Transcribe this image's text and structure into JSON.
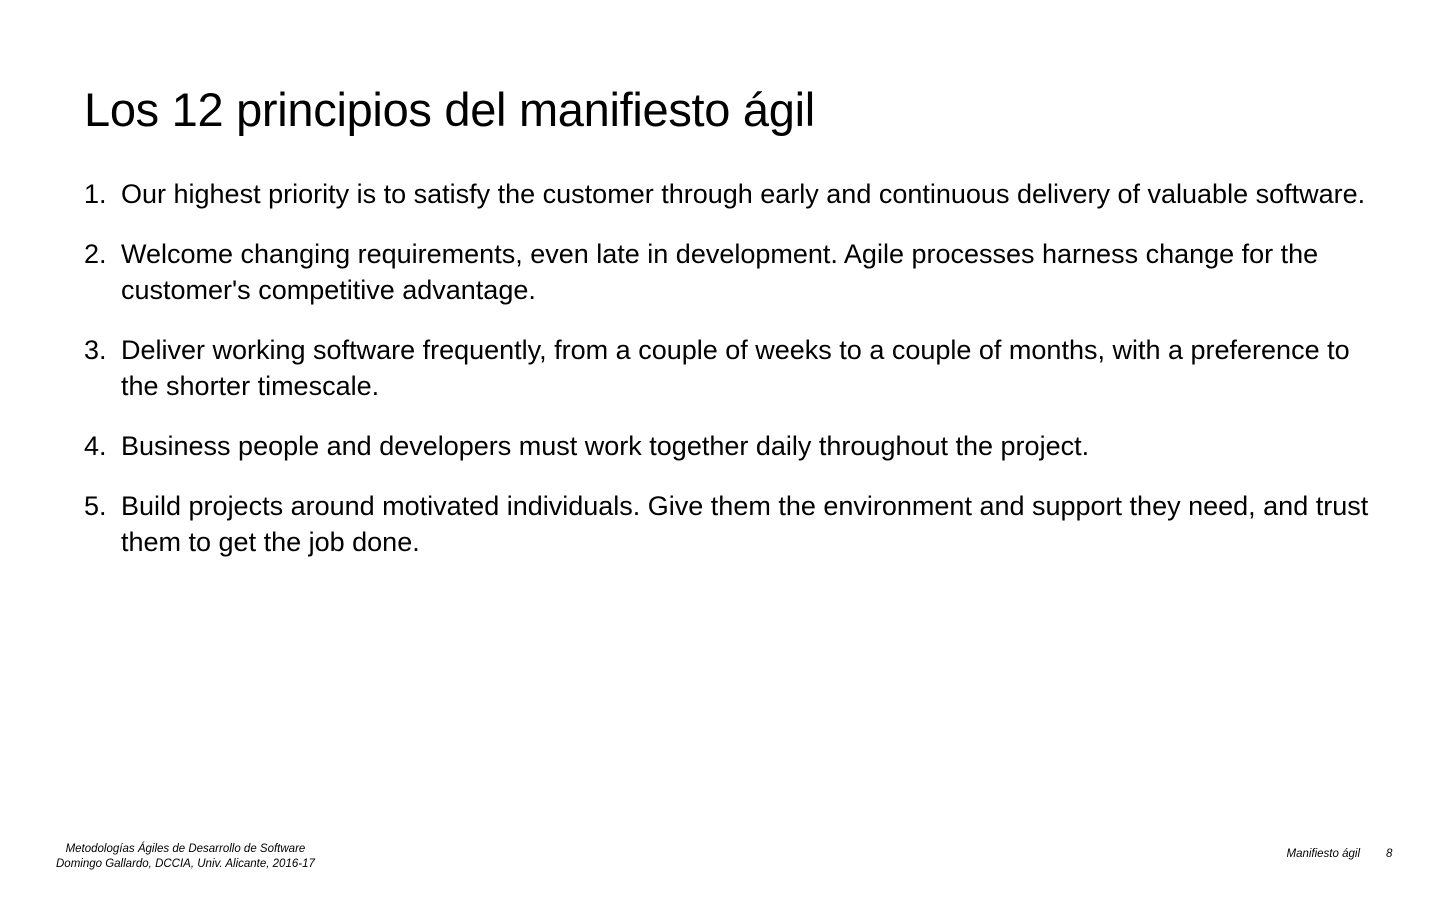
{
  "slide": {
    "title": "Los 12 principios del manifiesto ágil",
    "principles": [
      {
        "number": "1.",
        "text": "Our highest priority is to satisfy the customer through early and continuous delivery of valuable software."
      },
      {
        "number": "2.",
        "text": "Welcome changing requirements, even late in development. Agile processes harness change for the customer's competitive advantage."
      },
      {
        "number": "3.",
        "text": "Deliver working software frequently, from a couple of weeks to a couple of months, with a preference to the shorter timescale."
      },
      {
        "number": "4.",
        "text": "Business people and developers must work together daily throughout the project."
      },
      {
        "number": "5.",
        "text": "Build projects around motivated individuals. Give them the environment and support they need, and trust them to get the job done."
      }
    ]
  },
  "footer": {
    "course": "Metodologías Ágiles de Desarrollo de Software",
    "author": "Domingo Gallardo, DCCIA, Univ. Alicante, 2016-17",
    "section": "Manifiesto ágil",
    "page_number": "8"
  }
}
